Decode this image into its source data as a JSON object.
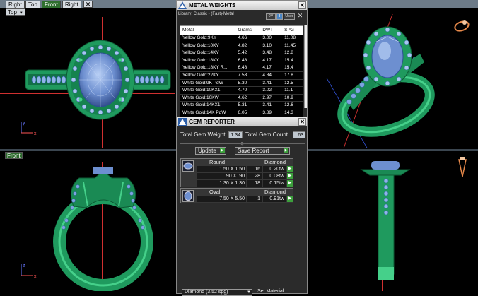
{
  "viewport_tabs": [
    {
      "label": "Right",
      "active": false
    },
    {
      "label": "Top",
      "active": false
    },
    {
      "label": "Front",
      "active": true
    },
    {
      "label": "Right",
      "active": false
    }
  ],
  "viewport_tab_close": "✕",
  "viewports": {
    "top_left": {
      "label": "Top",
      "has_dropdown": true
    },
    "bottom_left": {
      "label": "Front"
    }
  },
  "axis_labels": {
    "x": "x",
    "y": "y",
    "z": "z"
  },
  "metal_weights": {
    "title": "METAL WEIGHTS",
    "library_label": "Library: Classic - (Fast)-Metal",
    "toolbar": [
      "0V",
      "I",
      "User"
    ],
    "columns": [
      "Metal",
      "Grams",
      "DWT",
      "SPG"
    ],
    "rows": [
      [
        "Yellow Gold:9KY",
        "4.66",
        "3.00",
        "11.08"
      ],
      [
        "Yellow Gold:10KY",
        "4.82",
        "3.10",
        "11.45"
      ],
      [
        "Yellow Gold:14KY",
        "5.42",
        "3.48",
        "12.8"
      ],
      [
        "Yellow Gold:18KY",
        "6.48",
        "4.17",
        "15.4"
      ],
      [
        "Yellow Gold:18KY R...",
        "6.48",
        "4.17",
        "15.4"
      ],
      [
        "Yellow Gold:22KY",
        "7.53",
        "4.84",
        "17.8"
      ],
      [
        "White Gold:9K PdW",
        "5.30",
        "3.41",
        "12.5"
      ],
      [
        "White Gold:10KX1",
        "4.70",
        "3.02",
        "11.1"
      ],
      [
        "White Gold:10KW",
        "4.62",
        "2.97",
        "10.9"
      ],
      [
        "White Gold:14KX1",
        "5.31",
        "3.41",
        "12.6"
      ],
      [
        "White Gold:14K PdW",
        "6.05",
        "3.89",
        "14.3"
      ]
    ]
  },
  "gem_reporter": {
    "title": "GEM REPORTER",
    "total_weight_label": "Total Gem Weight",
    "total_weight_value": "1.34",
    "total_count_label": "Total Gem Count",
    "total_count_value": "63",
    "update_button": "Update",
    "save_report_button": "Save Report",
    "groups": [
      {
        "shape": "Round",
        "material": "Diamond",
        "rows": [
          {
            "size": "1.50 X 1.50",
            "count": "16",
            "weight": "0.20tw"
          },
          {
            "size": ".90 X .90",
            "count": "28",
            "weight": "0.08tw"
          },
          {
            "size": "1.30 X 1.30",
            "count": "18",
            "weight": "0.15tw"
          }
        ]
      },
      {
        "shape": "Oval",
        "material": "Diamond",
        "rows": [
          {
            "size": "7.50 X 5.50",
            "count": "1",
            "weight": "0.91tw"
          }
        ]
      }
    ],
    "material_select": "Diamond (3.52 spg)",
    "set_material_button": "Set Material"
  },
  "colors": {
    "ring_metal": "#1f9a5e",
    "ring_highlight": "#45d08a",
    "gem": "#6d8fd0",
    "accent_green": "#3ca03c"
  }
}
